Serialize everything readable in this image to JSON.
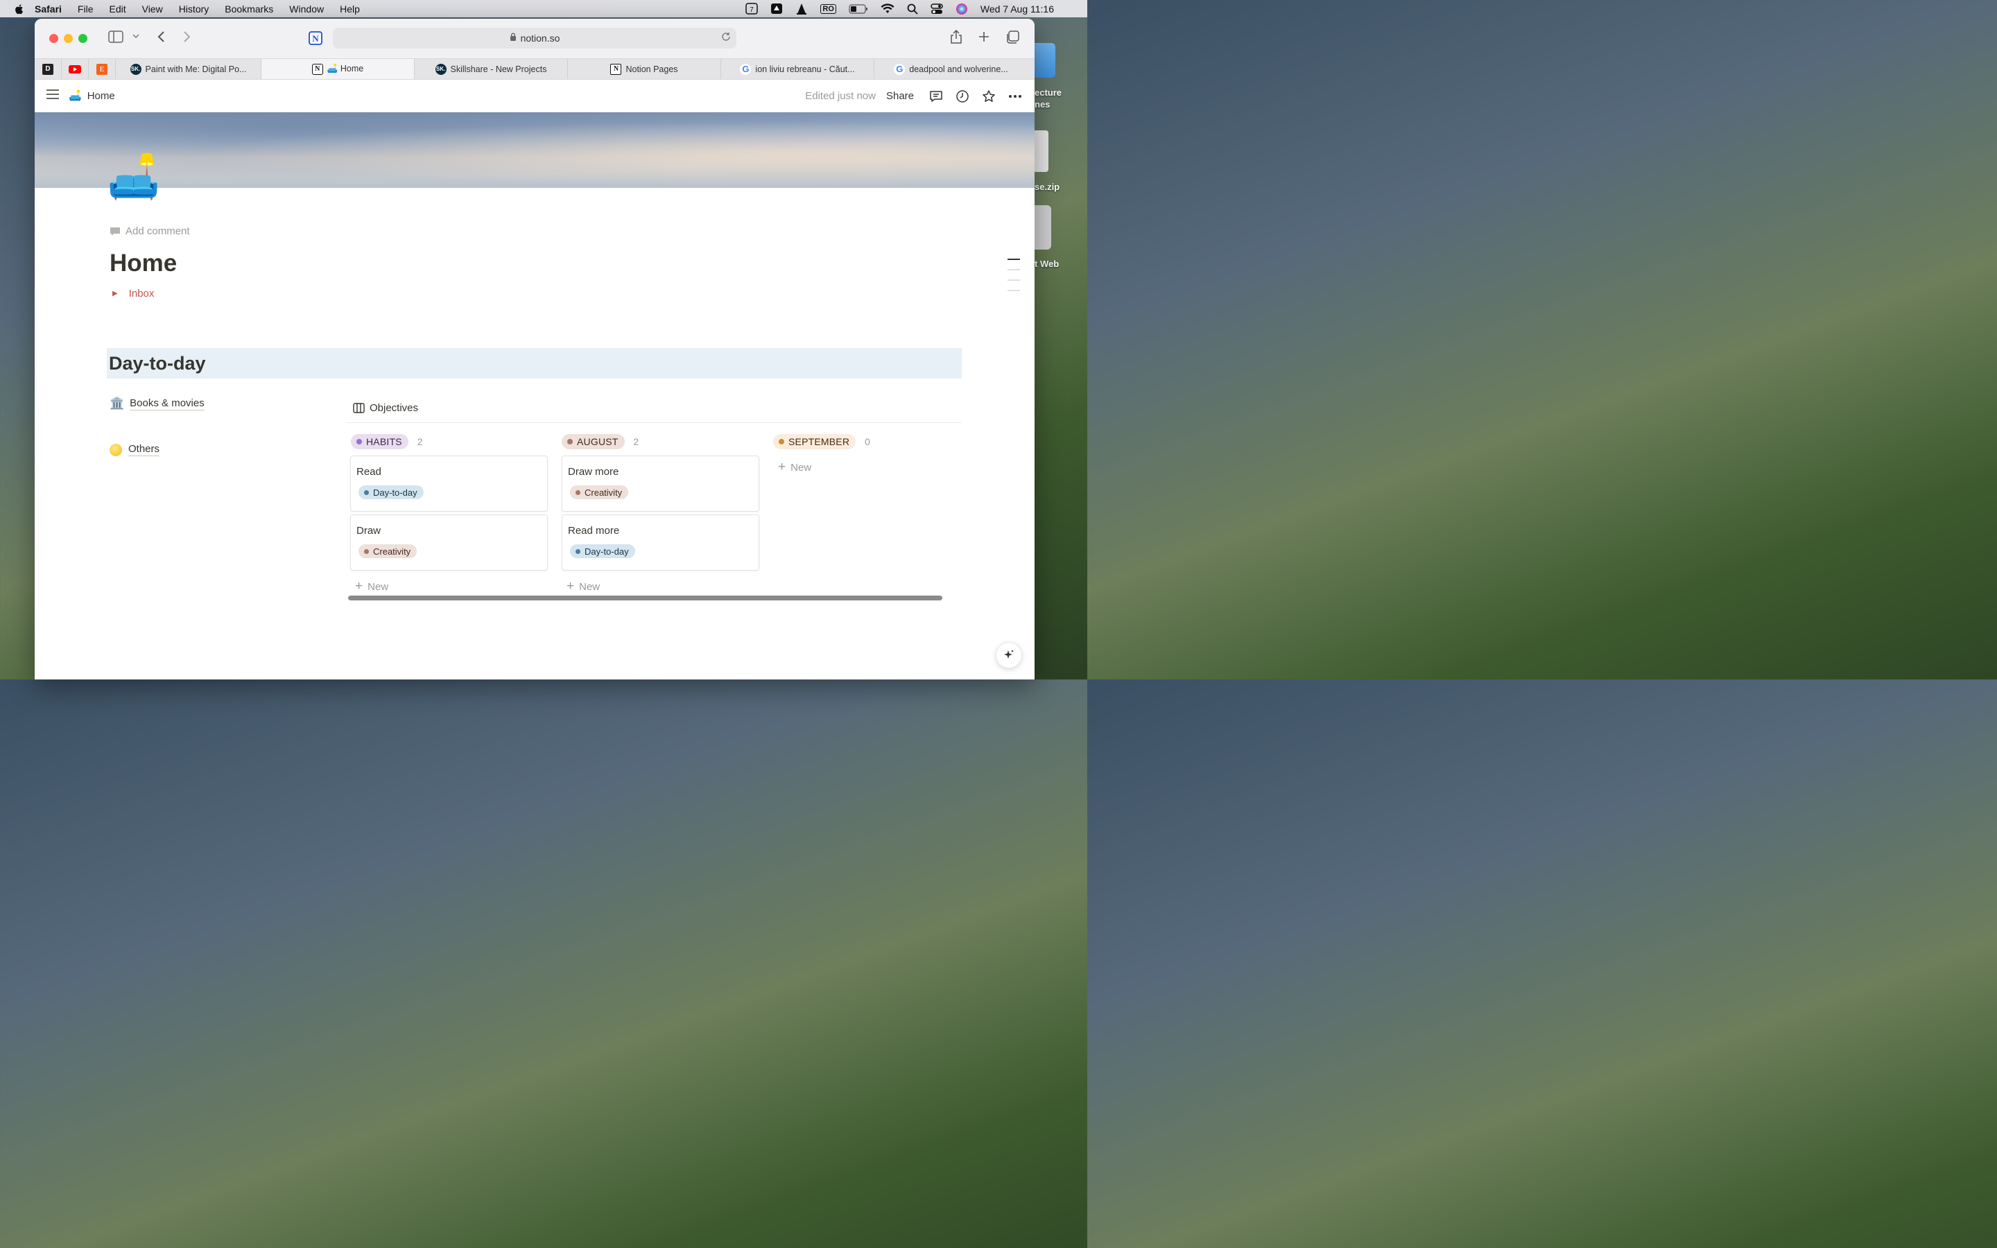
{
  "menubar": {
    "app": "Safari",
    "items": [
      "File",
      "Edit",
      "View",
      "History",
      "Bookmarks",
      "Window",
      "Help"
    ],
    "calendar_day": "7",
    "input_source": "RO",
    "clock": "Wed 7 Aug  11:16"
  },
  "desktop": {
    "labels": [
      "ecture",
      "nes",
      "se.zip",
      "t Web"
    ]
  },
  "browser": {
    "url": "notion.so",
    "tabs": [
      {
        "label": "Paint with Me: Digital Po...",
        "fav": "SK."
      },
      {
        "label": "🛋️ Home",
        "fav": "N",
        "active": true
      },
      {
        "label": "Skillshare - New Projects",
        "fav": "SK."
      },
      {
        "label": "Notion Pages",
        "fav": "N"
      },
      {
        "label": "ion liviu rebreanu - Căut...",
        "fav": "G"
      },
      {
        "label": "deadpool and wolverine...",
        "fav": "G"
      }
    ]
  },
  "header": {
    "crumb_icon": "🛋️",
    "crumb": "Home",
    "edited": "Edited just now",
    "share": "Share"
  },
  "page": {
    "icon": "🛋️",
    "add_comment": "Add comment",
    "title": "Home",
    "toggle": "Inbox",
    "section": "Day-to-day",
    "links": [
      {
        "icon": "🏛️",
        "label": "Books & movies"
      },
      {
        "icon": "🟡",
        "label": "Others"
      }
    ]
  },
  "board": {
    "title": "Objectives",
    "new_label": "New",
    "columns": [
      {
        "name": "HABITS",
        "count": "2",
        "cards": [
          {
            "title": "Read",
            "tag": "Day-to-day"
          },
          {
            "title": "Draw",
            "tag": "Creativity"
          }
        ]
      },
      {
        "name": "AUGUST",
        "count": "2",
        "cards": [
          {
            "title": "Draw more",
            "tag": "Creativity"
          },
          {
            "title": "Read more",
            "tag": "Day-to-day"
          }
        ]
      },
      {
        "name": "SEPTEMBER",
        "count": "0",
        "cards": []
      }
    ]
  },
  "colors": {
    "habits_bg": "#e8deee",
    "habits_dot": "#9a6dd7",
    "august_bg": "#eee0da",
    "august_dot": "#a27763",
    "september_bg": "#fbecdd",
    "september_dot": "#cb912f",
    "daytoday_bg": "#d3e5ef",
    "daytoday_dot": "#487ca5",
    "creativity_bg": "#eee0da",
    "creativity_dot": "#a27763",
    "section_bg": "#e7f0f6",
    "inbox_red": "#c4554d"
  }
}
